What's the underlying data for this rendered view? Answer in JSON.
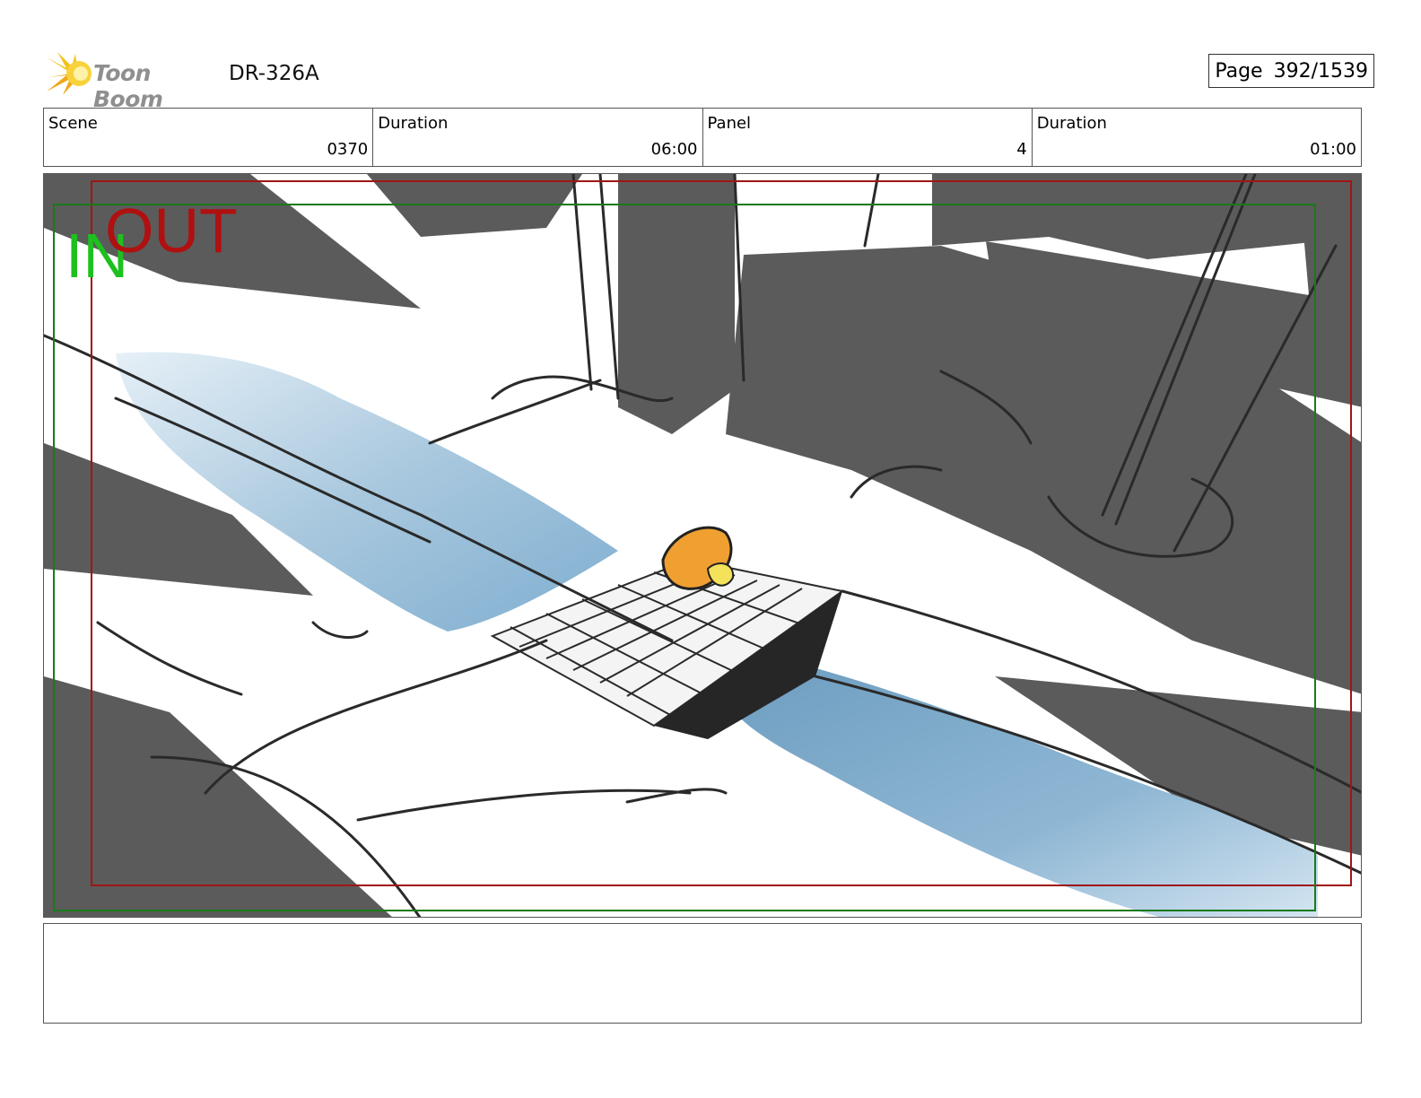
{
  "header": {
    "logo_text": "Toon Boom",
    "doc_id": "DR-326A",
    "page_label": "Page",
    "page_value": "392/1539"
  },
  "info": {
    "scene_label": "Scene",
    "scene_value": "0370",
    "scene_duration_label": "Duration",
    "scene_duration_value": "06:00",
    "panel_label": "Panel",
    "panel_value": "4",
    "panel_duration_label": "Duration",
    "panel_duration_value": "01:00"
  },
  "frame": {
    "out_label": "OUT",
    "in_label": "IN",
    "out_color": "#a01515",
    "in_color": "#1a7a1a"
  },
  "caption": {
    "text": ""
  }
}
